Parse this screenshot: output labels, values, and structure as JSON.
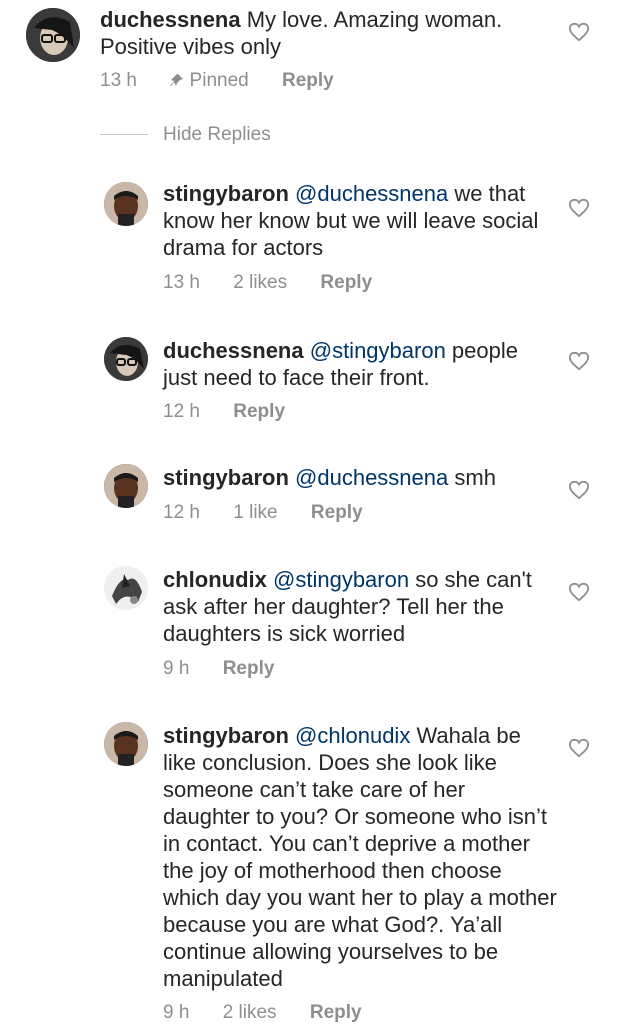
{
  "icons": {
    "like": "heart-outline-icon",
    "pinned": "pin-icon"
  },
  "colors": {
    "mention": "#003569",
    "meta": "#8e8e8e",
    "text": "#262626"
  },
  "main_comment": {
    "user": "duchessnena",
    "text": " My love. Amazing woman. Positive vibes only",
    "time": "13 h",
    "pinned": "Pinned",
    "reply": "Reply"
  },
  "hide_replies": "Hide Replies",
  "replies": [
    {
      "user": "stingybaron",
      "mention": "@duchessnena",
      "text": " we that know her know but we will leave social drama for actors",
      "time": "13 h",
      "likes": "2 likes",
      "reply": "Reply"
    },
    {
      "user": "duchessnena",
      "mention": "@stingybaron",
      "text": " people just need to face their front.",
      "time": "12 h",
      "likes": "",
      "reply": "Reply"
    },
    {
      "user": "stingybaron",
      "mention": "@duchessnena",
      "text": " smh",
      "time": "12 h",
      "likes": "1 like",
      "reply": "Reply"
    },
    {
      "user": "chlonudix",
      "mention": "@stingybaron",
      "text": " so she can't ask after her daughter? Tell her the daughters is sick worried",
      "time": "9 h",
      "likes": "",
      "reply": "Reply"
    },
    {
      "user": "stingybaron",
      "mention": "@chlonudix",
      "text": " Wahala be like conclusion. Does she look like someone can’t take care of her daughter to you? Or someone who isn’t in contact. You can’t deprive a mother the joy of motherhood then choose which day you want her to play a mother because you are what God?. Ya’all continue allowing yourselves to be manipulated",
      "time": "9 h",
      "likes": "2 likes",
      "reply": "Reply"
    }
  ]
}
